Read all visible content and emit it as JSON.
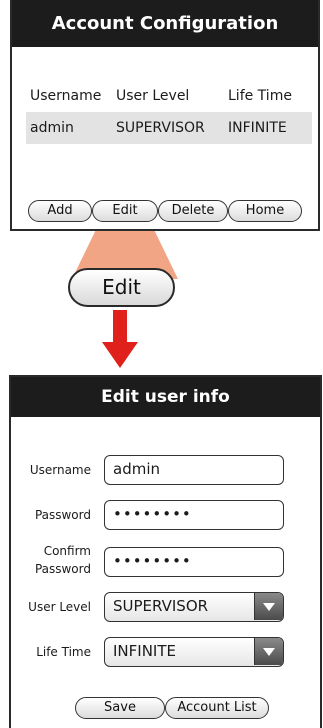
{
  "account_config": {
    "title": "Account Configuration",
    "columns": [
      "Username",
      "User Level",
      "Life Time"
    ],
    "rows": [
      [
        "admin",
        "SUPERVISOR",
        "INFINITE"
      ]
    ],
    "buttons": {
      "add": "Add",
      "edit": "Edit",
      "delete": "Delete",
      "home": "Home"
    }
  },
  "transition": {
    "edit_label": "Edit",
    "highlight_color": "#f2a585",
    "arrow_color": "#e0211b"
  },
  "edit_user": {
    "title": "Edit user info",
    "username_label": "Username",
    "username_value": "admin",
    "password_label": "Password",
    "password_value": "••••••••",
    "confirm_label_1": "Confirm",
    "confirm_label_2": "Password",
    "confirm_value": "••••••••",
    "user_level_label": "User Level",
    "user_level_value": "SUPERVISOR",
    "life_time_label": "Life Time",
    "life_time_value": "INFINITE",
    "save_label": "Save",
    "account_list_label": "Account List"
  }
}
